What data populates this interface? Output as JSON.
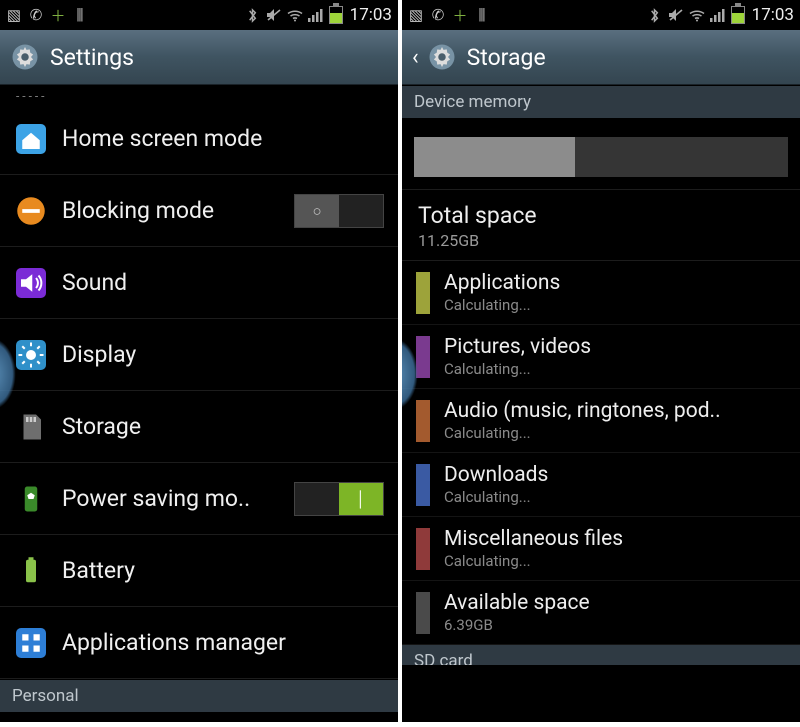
{
  "status": {
    "time": "17:03",
    "icons_left": [
      "image-icon",
      "whatsapp-icon",
      "plus-icon",
      "bars-icon"
    ],
    "icons_right": [
      "bluetooth-icon",
      "mute-icon",
      "wifi-icon",
      "signal-icon",
      "battery-icon"
    ]
  },
  "left": {
    "header_title": "Settings",
    "items": [
      {
        "label": "Home screen mode",
        "icon": "home-icon",
        "icon_color": "#3ca3e6",
        "type": "plain"
      },
      {
        "label": "Blocking mode",
        "icon": "minus-icon",
        "icon_color": "#e88a1f",
        "type": "toggle",
        "toggle_on": false
      },
      {
        "label": "Sound",
        "icon": "sound-icon",
        "icon_color": "#7b2bd6",
        "type": "plain"
      },
      {
        "label": "Display",
        "icon": "display-icon",
        "icon_color": "#2f90c9",
        "type": "plain"
      },
      {
        "label": "Storage",
        "icon": "sd-icon",
        "icon_color": "#6e6e6e",
        "type": "plain"
      },
      {
        "label": "Power saving mo..",
        "icon": "recycle-icon",
        "icon_color": "#3a8a2a",
        "type": "toggle",
        "toggle_on": true
      },
      {
        "label": "Battery",
        "icon": "battery-icon",
        "icon_color": "#8ac24a",
        "type": "plain"
      },
      {
        "label": "Applications manager",
        "icon": "apps-icon",
        "icon_color": "#2d7ed6",
        "type": "plain"
      }
    ],
    "footer_section": "Personal"
  },
  "right": {
    "header_title": "Storage",
    "section_header": "Device memory",
    "usage_fraction": 0.43,
    "total": {
      "title": "Total space",
      "value": "11.25GB"
    },
    "categories": [
      {
        "label": "Applications",
        "sub": "Calculating...",
        "color": "#9da33a"
      },
      {
        "label": "Pictures, videos",
        "sub": "Calculating...",
        "color": "#7a3a8f"
      },
      {
        "label": "Audio (music, ringtones, pod..",
        "sub": "Calculating...",
        "color": "#a35a2e"
      },
      {
        "label": "Downloads",
        "sub": "Calculating...",
        "color": "#3a5aa3"
      },
      {
        "label": "Miscellaneous files",
        "sub": "Calculating...",
        "color": "#8f3a3a"
      },
      {
        "label": "Available space",
        "sub": "6.39GB",
        "color": "#4a4a4a"
      }
    ],
    "footer_section": "SD card"
  }
}
